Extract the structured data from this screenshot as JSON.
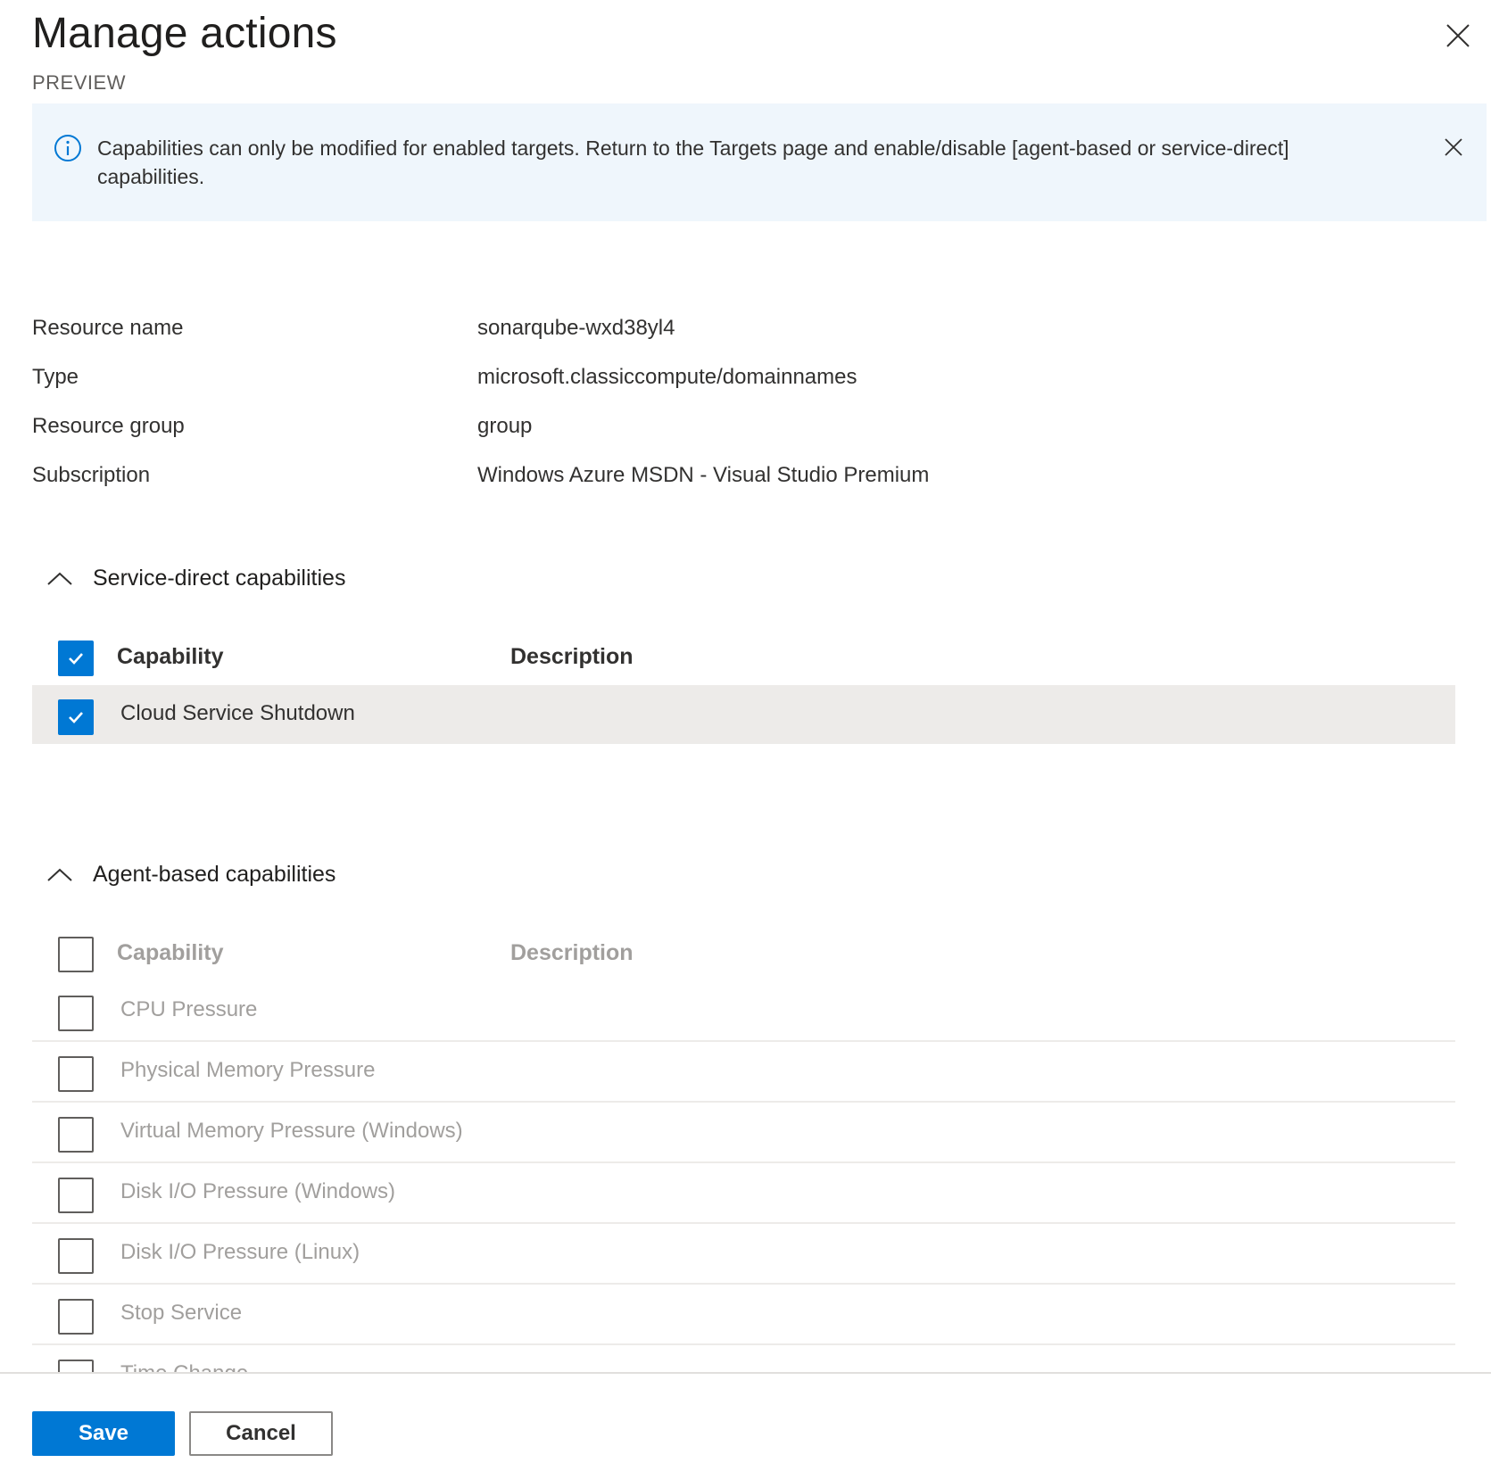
{
  "header": {
    "title": "Manage actions",
    "subtitle": "PREVIEW",
    "close_icon": "close-icon"
  },
  "info_bar": {
    "icon": "info-icon",
    "message": "Capabilities can only be modified for enabled targets. Return to the Targets page and enable/disable [agent-based or service-direct] capabilities.",
    "close_icon": "close-icon",
    "background": "#eff6fc",
    "icon_color": "#0078d4"
  },
  "properties": [
    {
      "label": "Resource name",
      "value": "sonarqube-wxd38yl4"
    },
    {
      "label": "Type",
      "value": "microsoft.classiccompute/domainnames"
    },
    {
      "label": "Resource group",
      "value": "group"
    },
    {
      "label": "Subscription",
      "value": "Windows Azure MSDN - Visual Studio Premium"
    }
  ],
  "service_direct": {
    "title": "Service-direct capabilities",
    "expanded": true,
    "header": {
      "capability": "Capability",
      "description": "Description",
      "checked": true
    },
    "rows": [
      {
        "capability": "Cloud Service Shutdown",
        "description": "",
        "checked": true
      }
    ]
  },
  "agent_based": {
    "title": "Agent-based capabilities",
    "expanded": true,
    "disabled": true,
    "header": {
      "capability": "Capability",
      "description": "Description",
      "checked": false
    },
    "rows": [
      {
        "capability": "CPU Pressure",
        "checked": false
      },
      {
        "capability": "Physical Memory Pressure",
        "checked": false
      },
      {
        "capability": "Virtual Memory Pressure (Windows)",
        "checked": false
      },
      {
        "capability": "Disk I/O Pressure (Windows)",
        "checked": false
      },
      {
        "capability": "Disk I/O Pressure (Linux)",
        "checked": false
      },
      {
        "capability": "Stop Service",
        "checked": false
      },
      {
        "capability": "Time Change",
        "checked": false
      }
    ]
  },
  "footer": {
    "save_label": "Save",
    "cancel_label": "Cancel"
  },
  "colors": {
    "accent": "#0078d4",
    "selected_row": "#edebe9",
    "disabled_text": "#a19f9d"
  }
}
